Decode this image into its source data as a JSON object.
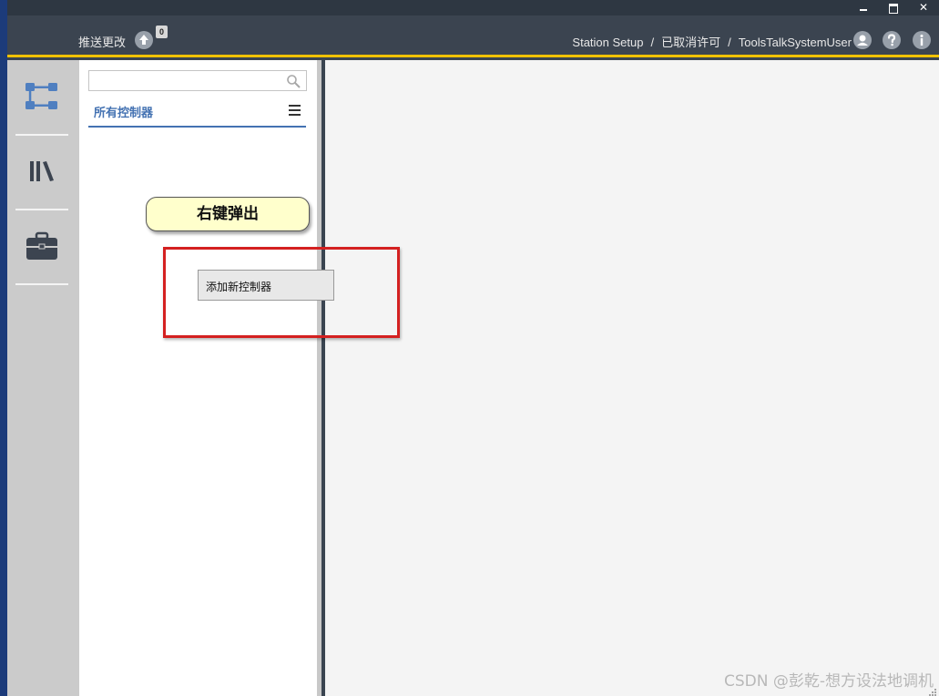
{
  "window": {
    "controls": {
      "minimize": "minimize",
      "maximize": "maximize",
      "close": "✕"
    }
  },
  "header": {
    "push_label": "推送更改",
    "push_count": "0",
    "breadcrumb": [
      "Station Setup",
      "已取消许可",
      "ToolsTalkSystemUser"
    ],
    "separator": "/",
    "icons": [
      "user-icon",
      "help-icon",
      "info-icon"
    ]
  },
  "rail": {
    "items": [
      {
        "icon": "controller-network-icon"
      },
      {
        "icon": "library-icon"
      },
      {
        "icon": "toolbox-icon"
      }
    ]
  },
  "panel": {
    "search": {
      "value": "",
      "placeholder": ""
    },
    "tab_label": "所有控制器"
  },
  "annotation": {
    "callout_text": "右键弹出"
  },
  "context_menu": {
    "items": [
      "添加新控制器"
    ]
  },
  "watermark": "CSDN @彭乾-想方设法地调机",
  "colors": {
    "header_bg": "#3b4450",
    "accent_yellow": "#f0c200",
    "rail_bg": "#cbcbcb",
    "tab_blue": "#4472b2",
    "highlight_red": "#d42020",
    "callout_bg": "#ffffcc"
  }
}
